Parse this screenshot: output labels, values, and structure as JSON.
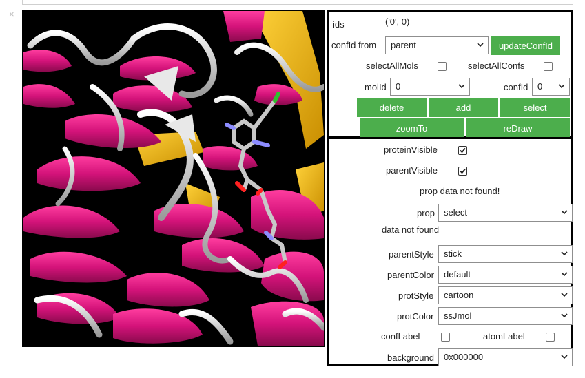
{
  "close_glyph": "×",
  "panel1": {
    "ids_label": "ids",
    "ids_value": "('0', 0)",
    "confid_from_label": "confId from",
    "confid_from_value": "parent",
    "update_button": "updateConfId",
    "select_all_mols_label": "selectAllMols",
    "select_all_mols_checked": false,
    "select_all_confs_label": "selectAllConfs",
    "select_all_confs_checked": false,
    "molid_label": "molId",
    "molid_value": "0",
    "confid_label": "confId",
    "confid_value": "0",
    "delete_button": "delete",
    "add_button": "add",
    "select_button": "select",
    "zoomto_button": "zoomTo",
    "redraw_button": "reDraw"
  },
  "panel2": {
    "protein_visible_label": "proteinVisible",
    "protein_visible_checked": true,
    "parent_visible_label": "parentVisible",
    "parent_visible_checked": true,
    "prop_message": "prop data not found!",
    "prop_label": "prop",
    "prop_value": "select",
    "data_message": "data not found",
    "parent_style_label": "parentStyle",
    "parent_style_value": "stick",
    "parent_color_label": "parentColor",
    "parent_color_value": "default",
    "prot_style_label": "protStyle",
    "prot_style_value": "cartoon",
    "prot_color_label": "protColor",
    "prot_color_value": "ssJmol",
    "conf_label_label": "confLabel",
    "conf_label_checked": false,
    "atom_label_label": "atomLabel",
    "atom_label_checked": false,
    "background_label": "background",
    "background_value": "0x000000"
  },
  "colors": {
    "button_green": "#4cae4c",
    "helix_magenta": "#e0167f",
    "sheet_gold": "#f0b400",
    "coil_white": "#d4d4d4",
    "viewer_background": "#000000"
  }
}
